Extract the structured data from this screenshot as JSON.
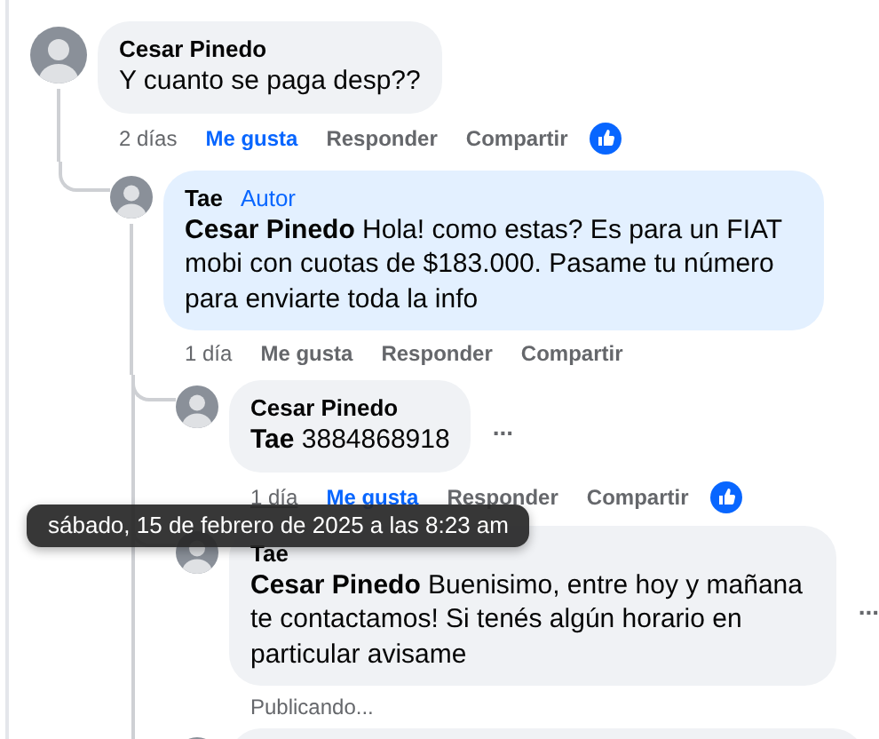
{
  "comments": [
    {
      "kind": "comment",
      "author": "Cesar Pinedo",
      "text": "Y cuanto se paga desp??",
      "highlighted": false,
      "time": "2 días",
      "time_hover": false,
      "like": "Me gusta",
      "liked": true,
      "reply": "Responder",
      "share": "Compartir",
      "children": [
        {
          "kind": "comment",
          "author": "Tae",
          "badge": "Autor",
          "text": "**Cesar Pinedo** Hola! como estas? Es para un FIAT mobi con cuotas de $183.000. Pasame tu número para enviarte toda la info",
          "highlighted": true,
          "time": "1 día",
          "time_hover": false,
          "like": "Me gusta",
          "liked": false,
          "reply": "Responder",
          "share": "Compartir",
          "children": [
            {
              "kind": "comment",
              "author": "Cesar Pinedo",
              "text": "**Tae** 3884868918",
              "more": "...",
              "highlighted": false,
              "time": "1 día",
              "time_hover": true,
              "like": "Me gusta",
              "liked": true,
              "reply": "Responder",
              "share": "Compartir"
            },
            {
              "kind": "comment",
              "author": "Tae",
              "text": "**Cesar Pinedo** Buenisimo, entre hoy y mañana te contactamos! Si tenés algún horario en particular avisame",
              "more": "...",
              "highlighted": false,
              "status": "Publicando..."
            },
            {
              "kind": "partial"
            }
          ]
        }
      ]
    }
  ],
  "tooltip": "sábado, 15 de febrero de 2025 a las 8:23 am"
}
